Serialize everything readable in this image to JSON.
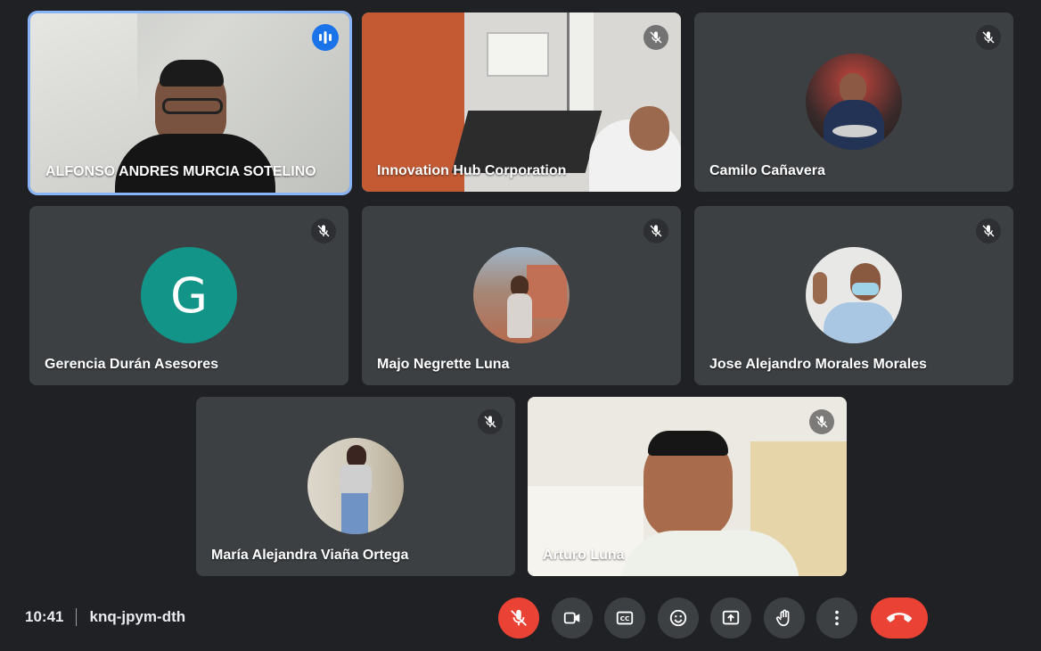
{
  "participants": [
    {
      "name": "ALFONSO ANDRES MURCIA SOTELINO",
      "speaking": true
    },
    {
      "name": "Innovation Hub Corporation",
      "muted": true
    },
    {
      "name": "Camilo Cañavera",
      "muted": true
    },
    {
      "name": "Gerencia Durán Asesores",
      "muted": true,
      "initial": "G",
      "avatar_color": "#129488"
    },
    {
      "name": "Majo Negrette Luna",
      "muted": true
    },
    {
      "name": "Jose Alejandro Morales Morales",
      "muted": true
    },
    {
      "name": "María Alejandra Viaña Ortega",
      "muted": true
    },
    {
      "name": "Arturo Luna",
      "muted": true
    }
  ],
  "meeting": {
    "time": "10:41",
    "code": "knq-jpym-dth"
  },
  "controls": [
    "mic-off-icon",
    "camera-icon",
    "captions-icon",
    "emoji-icon",
    "present-icon",
    "raise-hand-icon",
    "more-options-icon",
    "end-call-icon"
  ],
  "colors": {
    "background": "#202124",
    "tile": "#3c4043",
    "danger": "#ea4335",
    "speaking": "#1a73e8"
  }
}
